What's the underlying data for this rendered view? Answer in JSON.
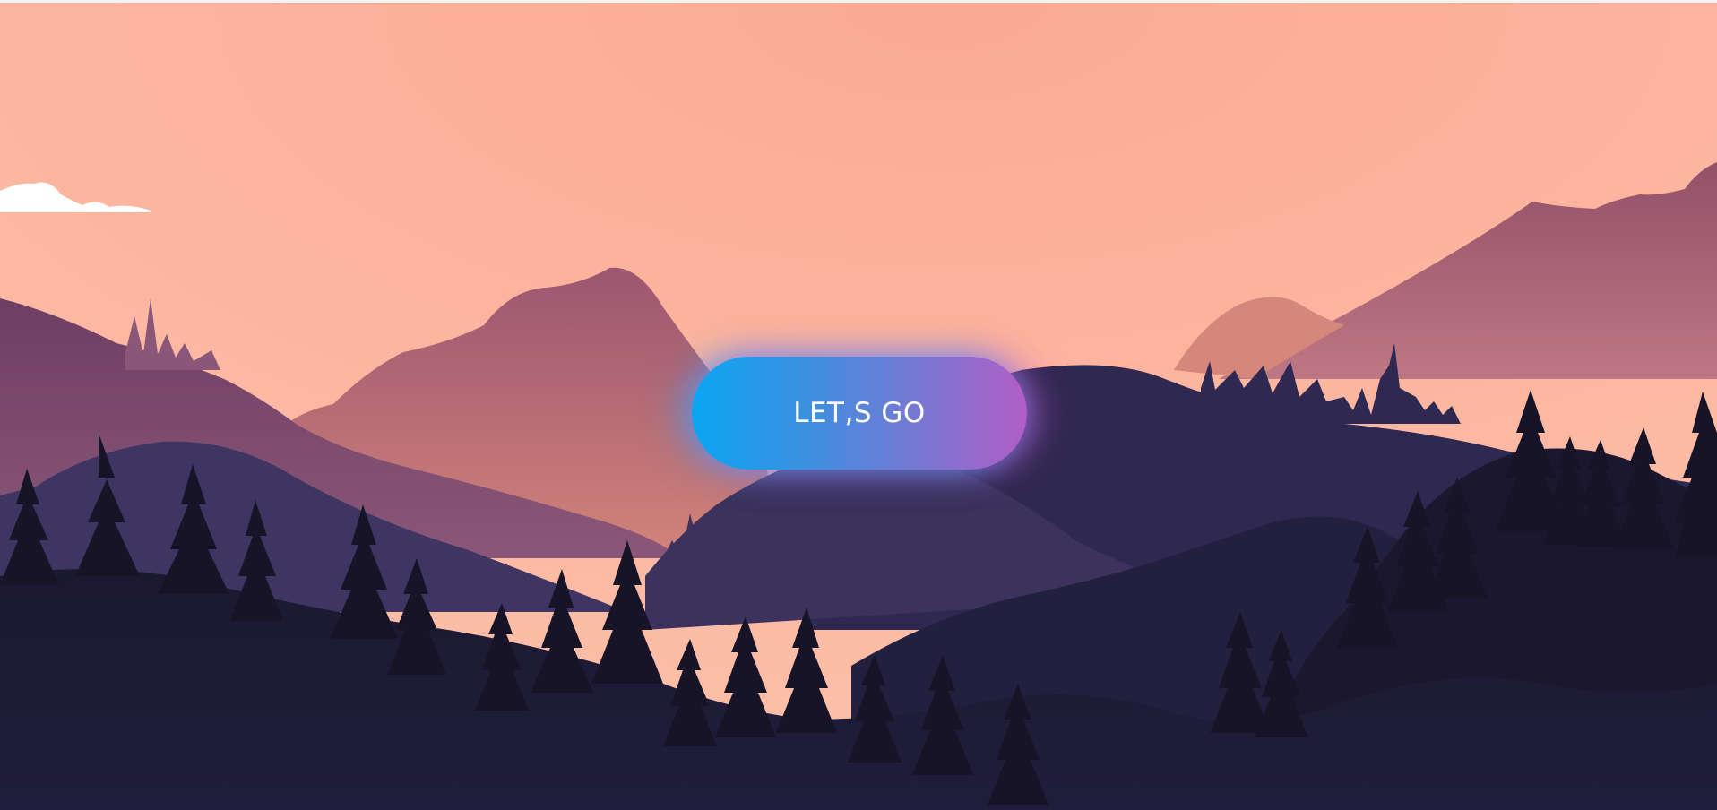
{
  "hero": {
    "cta_label": "LET,S GO",
    "sky_color": "#fdbaa3",
    "accent_gradient": [
      "#0aa6f2",
      "#b15ec6"
    ],
    "forest_color": "#161428"
  }
}
